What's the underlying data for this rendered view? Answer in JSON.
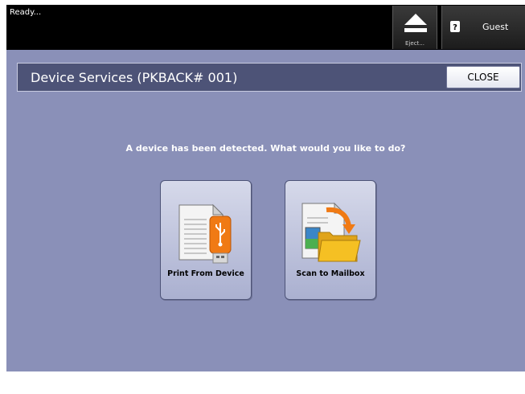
{
  "status": {
    "text": "Ready..."
  },
  "header": {
    "eject_label": "Eject...",
    "user_label": "Guest"
  },
  "panel": {
    "title": "Device Services (PKBACK# 001)",
    "close_label": "CLOSE",
    "prompt": "A device has been detected.  What would you like to do?"
  },
  "actions": [
    {
      "label": "Print From Device",
      "icon": "print-from-usb-icon"
    },
    {
      "label": "Scan to Mailbox",
      "icon": "scan-to-mailbox-icon"
    }
  ],
  "colors": {
    "panel_background": "#8a90b8",
    "titlebar": "#4d5377",
    "usb_orange": "#f07a14",
    "folder_yellow": "#f5c023"
  }
}
